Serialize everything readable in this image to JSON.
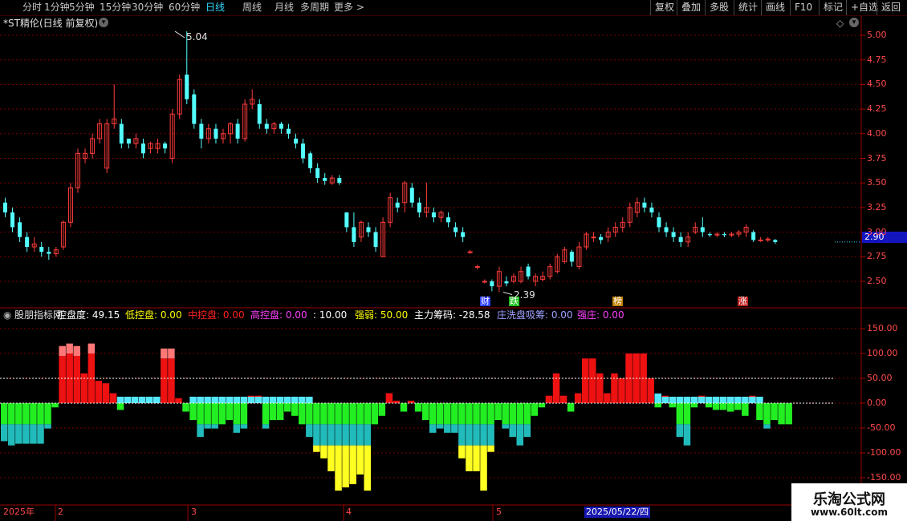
{
  "toolbar": {
    "timeframes": [
      "分时",
      "1分钟",
      "5分钟",
      "15分钟",
      "30分钟",
      "60分钟",
      "日线",
      "周线",
      "月线",
      "多周期",
      "更多 >"
    ],
    "active": "日线",
    "right_buttons": [
      "复权",
      "叠加",
      "多股",
      "统计",
      "画线",
      "F10",
      "标记",
      "+自选",
      "返回"
    ]
  },
  "stock": {
    "title": "*ST精伦(日线 前复权)"
  },
  "price_panel": {
    "yaxis": [
      "5.00",
      "4.75",
      "4.50",
      "4.25",
      "4.00",
      "3.75",
      "3.50",
      "3.25",
      "3.00",
      "2.75",
      "2.50"
    ],
    "current_price": "2.90",
    "high_label": "5.04",
    "low_label": "2.39",
    "markers": [
      "财",
      "跌",
      "榜",
      "涨"
    ]
  },
  "indicator": {
    "name": "股朋指标网",
    "items": [
      {
        "label": "控盘度:",
        "value": "49.15",
        "color": "#ffffff"
      },
      {
        "label": "低控盘:",
        "value": "0.00",
        "color": "#ffff00"
      },
      {
        "label": "中控盘:",
        "value": "0.00",
        "color": "#ff2020"
      },
      {
        "label": "高控盘:",
        "value": "0.00",
        "color": "#ff40ff"
      },
      {
        "label": ":",
        "value": "10.00",
        "color": "#ffffff"
      },
      {
        "label": "强弱:",
        "value": "50.00",
        "color": "#ffff00"
      },
      {
        "label": "主力筹码:",
        "value": "-28.58",
        "color": "#ffffff"
      },
      {
        "label": "庄洗盘吸筹:",
        "value": "0.00",
        "color": "#a0a0ff"
      },
      {
        "label": "强庄:",
        "value": "0.00",
        "color": "#ff40ff"
      }
    ],
    "yaxis": [
      "150.00",
      "100.00",
      "50.00",
      "0.00",
      "-50.00",
      "-100.00",
      "-150.00"
    ]
  },
  "date_bar": {
    "labels": [
      "2025年",
      "2",
      "3",
      "4",
      "5"
    ],
    "highlight": "2025/05/22/四"
  },
  "watermark": {
    "line1": "乐淘公式网",
    "line2": "www.60lt.com"
  },
  "colors": {
    "up": "#ff3c3c",
    "down": "#54ffff",
    "grid": "#7a0000",
    "accent": "#33d8ff"
  }
}
